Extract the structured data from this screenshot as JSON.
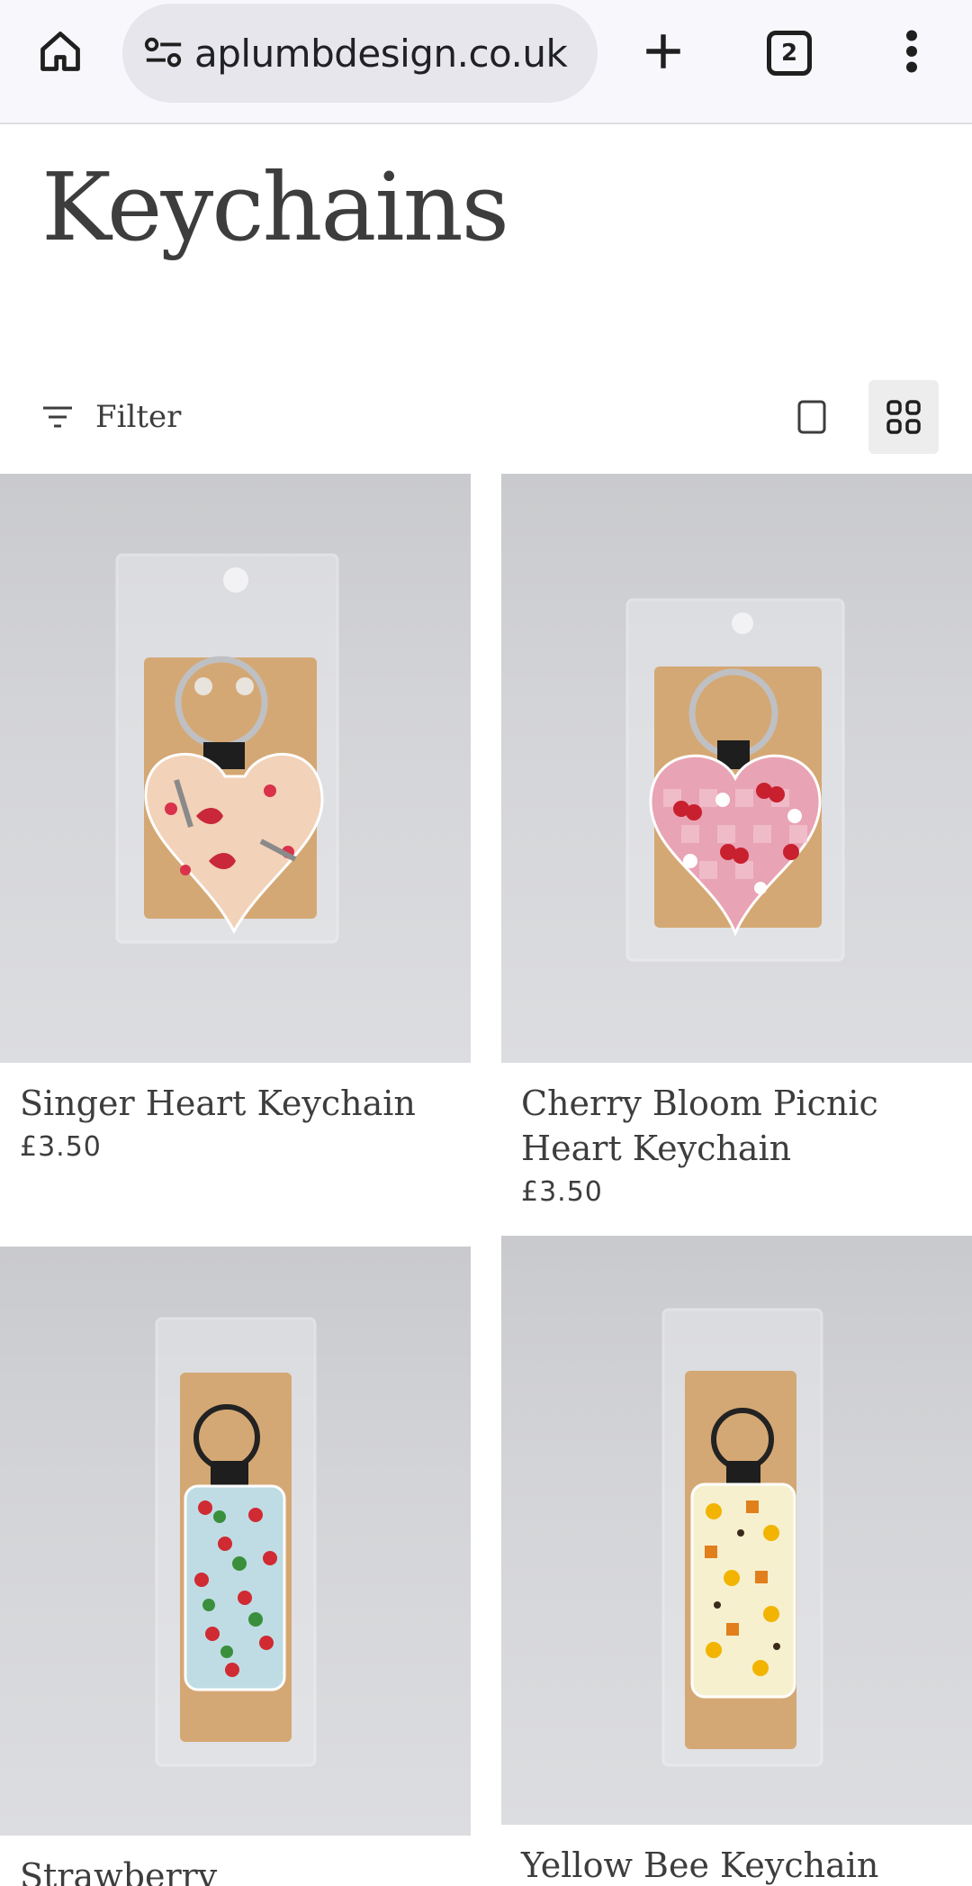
{
  "browser": {
    "url": "aplumbdesign.co.uk",
    "tab_count": "2",
    "icons": [
      "home-icon",
      "site-settings-icon",
      "new-tab-icon",
      "tab-switcher-icon",
      "more-menu-icon"
    ]
  },
  "page": {
    "title": "Keychains"
  },
  "toolbar": {
    "filter_label": "Filter",
    "icons": [
      "filter-icon",
      "single-column-view-icon",
      "grid-view-icon"
    ],
    "active_view": "grid"
  },
  "products": [
    {
      "name": "Singer Heart Keychain",
      "price": "£3.50"
    },
    {
      "name": "Cherry Bloom Picnic Heart Keychain",
      "price": "£3.50"
    },
    {
      "name": "Strawberry",
      "price": ""
    },
    {
      "name": "Yellow Bee Keychain",
      "price": ""
    }
  ],
  "colors": {
    "accent_text": "#3d3d3d",
    "chrome_bg": "#f8f7fc",
    "url_bg": "#e7e6ec",
    "photo_bg": "#d3d4d7"
  }
}
